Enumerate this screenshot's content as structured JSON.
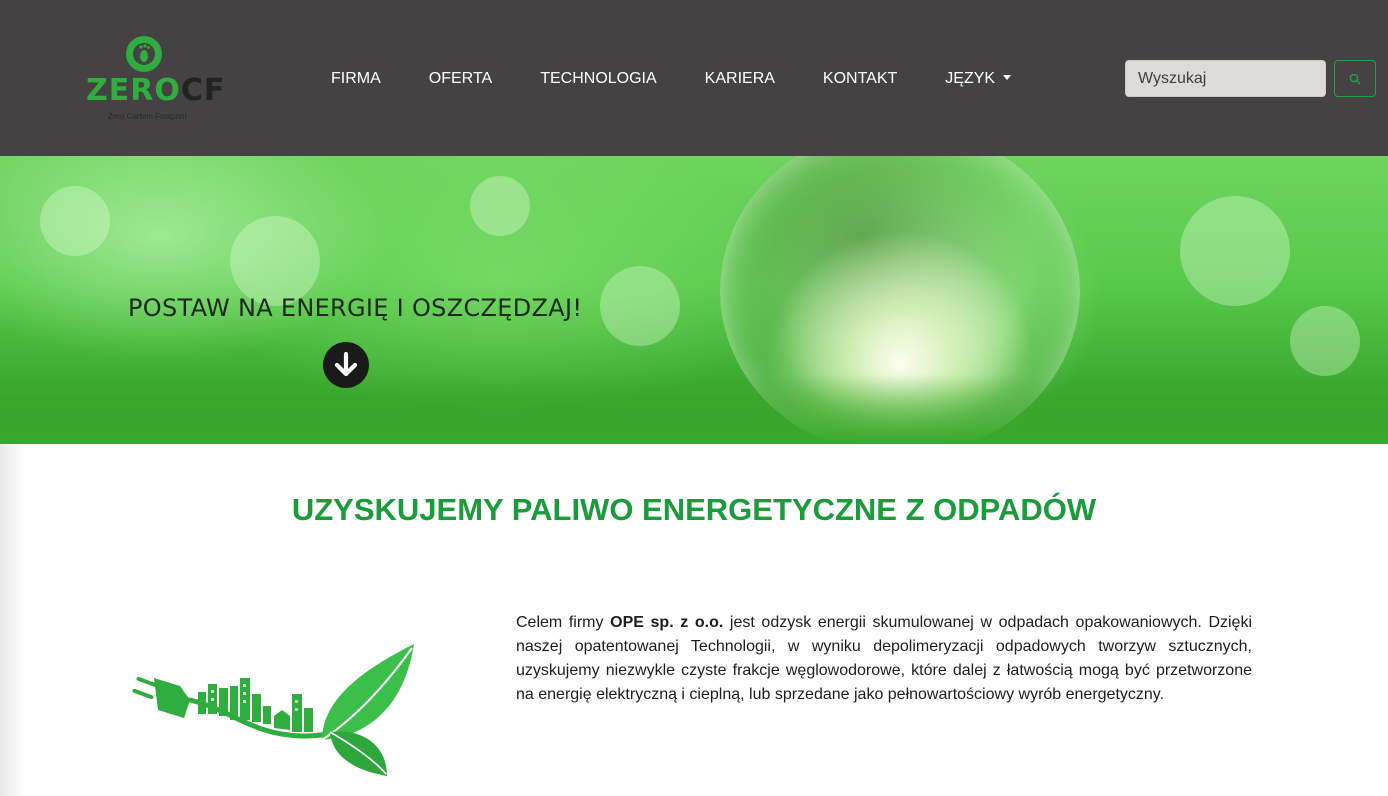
{
  "header": {
    "logo": {
      "word_main": "ZERO",
      "word_accent": "CF",
      "tagline": "Zero Carbon Footprint"
    },
    "nav": [
      {
        "label": "FIRMA"
      },
      {
        "label": "OFERTA"
      },
      {
        "label": "TECHNOLOGIA"
      },
      {
        "label": "KARIERA"
      },
      {
        "label": "KONTAKT"
      },
      {
        "label": "JĘZYK",
        "dropdown": true
      }
    ],
    "search": {
      "placeholder": "Wyszukaj",
      "icon": "search-icon"
    },
    "background_color": "#444242"
  },
  "hero": {
    "headline": "POSTAW NA ENERGIĘ I OSZCZĘDZAJ!",
    "arrow_icon": "arrow-down-circle-icon"
  },
  "main": {
    "title": "UZYSKUJEMY PALIWO ENERGETYCZNE Z ODPADÓW",
    "title_color": "#1a9c3a",
    "paragraph": {
      "before_bold": "Celem firmy ",
      "bold": "OPE sp. z o.o.",
      "after_bold": " jest odzysk energii skumulowanej w odpadach opakowaniowych. Dzięki naszej opatentowanej Technologii, w wyniku depolimeryzacji odpadowych tworzyw sztucznych, uzyskujemy niezwykle czyste frakcje węglowodorowe, które dalej z łatwością mogą być przetworzone na energię elektryczną i cieplną, lub sprzedane jako pełnowartościowy wyrób energetyczny."
    },
    "illustration_icon": "eco-plug-city-leaf-icon"
  }
}
